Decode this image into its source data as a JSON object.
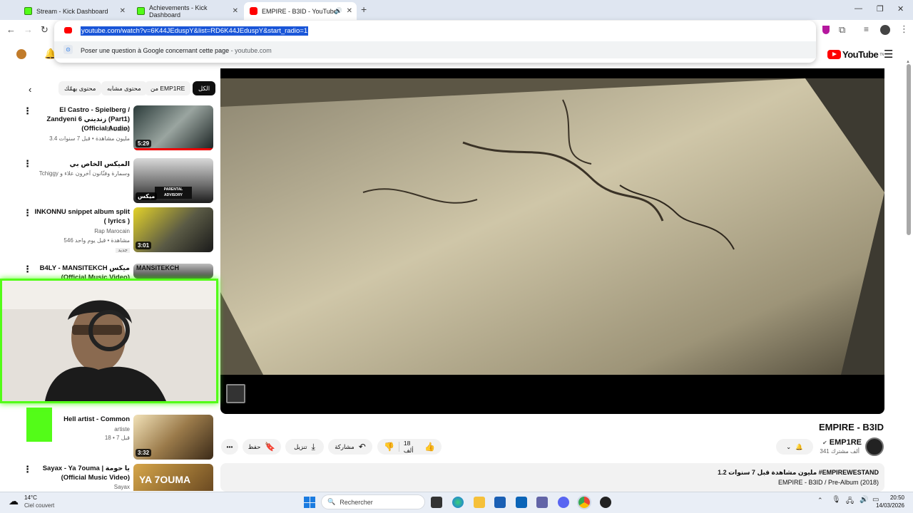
{
  "browser": {
    "tabs": [
      {
        "title": "Stream - Kick Dashboard",
        "favicon": "kick-icon"
      },
      {
        "title": "Achievements - Kick Dashboard",
        "favicon": "kick-icon"
      },
      {
        "title": "EMPIRE - B3ID - YouTube",
        "favicon": "youtube-icon"
      }
    ],
    "new_tab_label": "+",
    "omnibox": {
      "url": "youtube.com/watch?v=6K44JEduspY&list=RD6K44JEduspY&start_radio=1",
      "suggestion": "Poser une question à Google concernant cette page",
      "suggestion_domain": "youtube.com"
    }
  },
  "youtube": {
    "logo_text": "YouTube",
    "logo_sup": "TN",
    "chips": [
      "الكل",
      "من EMP1RE",
      "محتوى مشابه",
      "محتوى يهمّك"
    ],
    "playlist": [
      {
        "title": "El Castro - Spielberg / Zandyeni 6 زنديني (Part1) (Official Audio)",
        "channel": "El Castro",
        "meta": "3.4 مليون مشاهدة • قبل 7 سنوات",
        "duration": "5:29"
      },
      {
        "title": "الميكس الخاص بي",
        "channel": "Tchiggy وسمارة وفنّانون آخرون علاء و",
        "meta": "",
        "duration": "ميكس"
      },
      {
        "title": "INKONNU snippet album split ( lyrics )",
        "channel": "Rap Marocain",
        "meta": "546 مشاهدة • قبل يوم واحد",
        "badge": "جديد",
        "duration": "3:01"
      },
      {
        "title": "B4LY - MANSITEKCH ميكس (Official Music Video)",
        "channel": "",
        "meta": "",
        "duration": ""
      },
      {
        "title": "Hell artist - Common",
        "channel": "artiste",
        "meta": "18 • قبل 7",
        "duration": "3:32"
      },
      {
        "title": "Sayax - Ya 7ouma | يا حومة (Official Music Video)",
        "channel": "Sayax",
        "meta": "",
        "duration": ""
      }
    ],
    "video": {
      "title": "EMPIRE - B3ID",
      "channel": "EMP1RE",
      "subscribers": "341 ألف مشترك",
      "likes": "18 ألف",
      "share_label": "مشاركة",
      "download_label": "تنزيل",
      "save_label": "حفظ",
      "views_line": "1.2 مليون مشاهدة  قبل 7 سنوات  #EMPIREWESTAND",
      "desc_line": "EMPIRE - B3ID / Pre-Album (2018)"
    }
  },
  "taskbar": {
    "weather_temp": "14°C",
    "weather_desc": "Ciel couvert",
    "search_placeholder": "Rechercher",
    "time": "20:50",
    "date": "14/03/2026"
  },
  "colors": {
    "kick_green": "#53fc18",
    "youtube_red": "#ff0000",
    "selection_blue": "#1a56d8"
  }
}
